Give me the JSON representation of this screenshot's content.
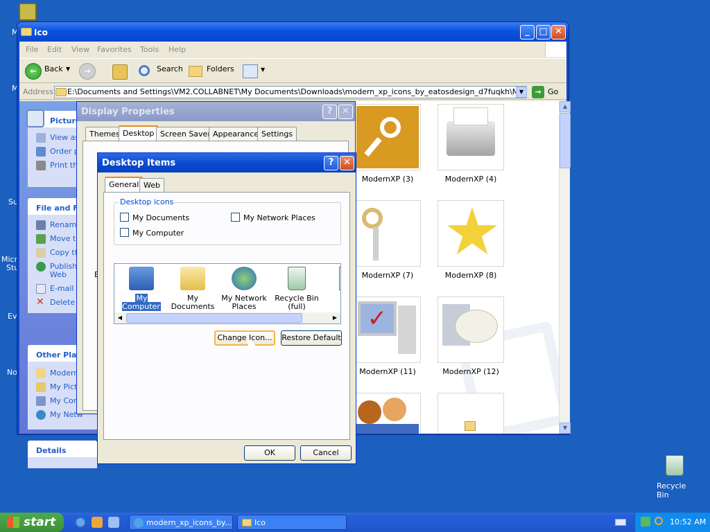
{
  "desktop": {
    "recycle_bin_label": "Recycle Bin",
    "edge_fragments": [
      "M",
      "M",
      "Su",
      "Micr",
      "Stu",
      "Ev",
      "No"
    ]
  },
  "explorer": {
    "title": "Ico",
    "menu": [
      "File",
      "Edit",
      "View",
      "Favorites",
      "Tools",
      "Help"
    ],
    "toolbar": {
      "back": "Back",
      "search": "Search",
      "folders": "Folders"
    },
    "address_label": "Address",
    "address_value": "E:\\Documents and Settings\\VM2.COLLABNET\\My Documents\\Downloads\\modern_xp_icons_by_eatosdesign_d7fuqkh\\Modern XP\\Ico",
    "go_label": "Go",
    "left_panel": {
      "picture_tasks": {
        "title": "Picture",
        "items": [
          "View as",
          "Order p",
          "Print th"
        ]
      },
      "file_tasks": {
        "title": "File and Fo",
        "items": [
          "Rename",
          "Move th",
          "Copy th",
          "Publish",
          "Web",
          "E-mail t",
          "Delete"
        ]
      },
      "other_places": {
        "title": "Other Plac",
        "items": [
          "Modern",
          "My Pict",
          "My Com",
          "My Netw"
        ]
      },
      "details": {
        "title": "Details"
      }
    },
    "files": [
      "ModernXP (3)",
      "ModernXP (4)",
      "ModernXP (7)",
      "ModernXP (8)",
      "ModernXP (11)",
      "ModernXP (12)"
    ]
  },
  "display_properties": {
    "title": "Display Properties",
    "help": "?",
    "close": "✕",
    "tabs": [
      "Themes",
      "Desktop",
      "Screen Saver",
      "Appearance",
      "Settings"
    ],
    "fragments": [
      "B"
    ]
  },
  "desktop_items": {
    "title": "Desktop Items",
    "help": "?",
    "close": "✕",
    "tabs": [
      "General",
      "Web"
    ],
    "group_label": "Desktop icons",
    "checkboxes": [
      {
        "label": "My Documents",
        "checked": false
      },
      {
        "label": "My Network Places",
        "checked": false
      },
      {
        "label": "My Computer",
        "checked": false
      }
    ],
    "icons": [
      {
        "line1": "My Computer",
        "line2": "",
        "selected": true
      },
      {
        "line1": "My Documents",
        "line2": "",
        "selected": false
      },
      {
        "line1": "My Network",
        "line2": "Places",
        "selected": false
      },
      {
        "line1": "Recycle Bin",
        "line2": "(full)",
        "selected": false
      },
      {
        "line1": "Re",
        "line2": "(e",
        "selected": false
      }
    ],
    "change_icon": "Change Icon...",
    "restore_default": "Restore Default",
    "ok": "OK",
    "cancel": "Cancel"
  },
  "taskbar": {
    "start": "start",
    "items": [
      "modern_xp_icons_by...",
      "Ico"
    ],
    "clock": "10:52 AM"
  },
  "colors": {
    "desktop": "#1b5fbf",
    "titlebar": "#0a52e0",
    "dialog": "#ece9d8",
    "start": "#3c8f3a",
    "link": "#215dc6"
  }
}
